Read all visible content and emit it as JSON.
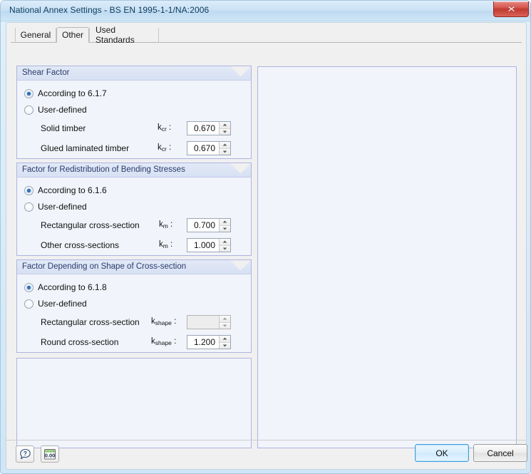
{
  "window": {
    "title": "National Annex Settings - BS EN 1995-1-1/NA:2006",
    "close_icon": "close-icon"
  },
  "tabs": [
    {
      "label": "General",
      "active": false
    },
    {
      "label": "Other",
      "active": true
    },
    {
      "label": "Used Standards",
      "active": false
    }
  ],
  "groups": [
    {
      "title": "Shear Factor",
      "options": [
        {
          "label": "According to 6.1.7",
          "checked": true
        },
        {
          "label": "User-defined",
          "checked": false
        }
      ],
      "fields": [
        {
          "label": "Solid timber",
          "symbol": "k",
          "subscript": "cr",
          "colon": ":",
          "value": "0.670",
          "disabled": false
        },
        {
          "label": "Glued laminated timber",
          "symbol": "k",
          "subscript": "cr",
          "colon": ":",
          "value": "0.670",
          "disabled": false
        }
      ]
    },
    {
      "title": "Factor for Redistribution of Bending Stresses",
      "options": [
        {
          "label": "According to 6.1.6",
          "checked": true
        },
        {
          "label": "User-defined",
          "checked": false
        }
      ],
      "fields": [
        {
          "label": "Rectangular cross-section",
          "symbol": "k",
          "subscript": "m",
          "colon": ":",
          "value": "0.700",
          "disabled": false
        },
        {
          "label": "Other cross-sections",
          "symbol": "k",
          "subscript": "m",
          "colon": ":",
          "value": "1.000",
          "disabled": false
        }
      ]
    },
    {
      "title": "Factor Depending on Shape of Cross-section",
      "options": [
        {
          "label": "According to 6.1.8",
          "checked": true
        },
        {
          "label": "User-defined",
          "checked": false
        }
      ],
      "fields": [
        {
          "label": "Rectangular cross-section",
          "symbol": "k",
          "subscript": "shape",
          "colon": ":",
          "value": "",
          "disabled": true
        },
        {
          "label": "Round cross-section",
          "symbol": "k",
          "subscript": "shape",
          "colon": ":",
          "value": "1.200",
          "disabled": false
        }
      ]
    }
  ],
  "footer": {
    "help_icon": "help-icon",
    "units_icon": "decimal-places-icon",
    "units_label": "0.00",
    "ok_label": "OK",
    "cancel_label": "Cancel"
  },
  "colors": {
    "accent": "#2e6fb7",
    "group_border": "#aeb4e0",
    "group_header": "#d7e1f3",
    "panel_fill": "#f1f4fa",
    "close_red": "#c0392f",
    "default_button_border": "#3c9ede"
  }
}
